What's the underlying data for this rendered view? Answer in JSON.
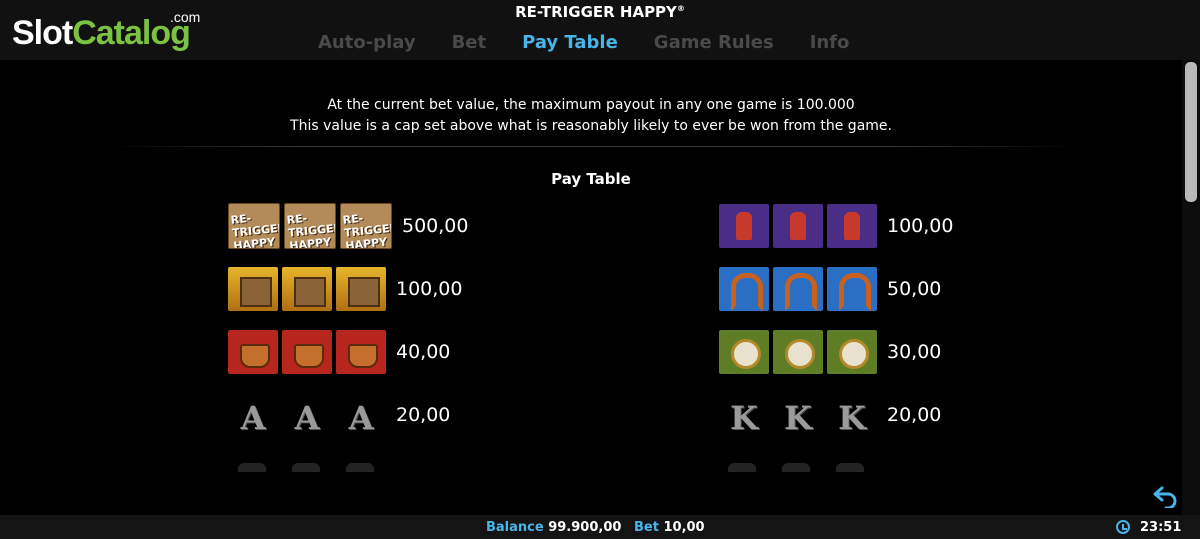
{
  "branding": {
    "logo_slot": "Slot",
    "logo_catalog": "Catalog",
    "logo_com": ".com"
  },
  "header": {
    "title": "RE-TRIGGER HAPPY",
    "trademark": "®"
  },
  "tabs": [
    {
      "label": "Auto-play",
      "active": false
    },
    {
      "label": "Bet",
      "active": false
    },
    {
      "label": "Pay Table",
      "active": true
    },
    {
      "label": "Game Rules",
      "active": false
    },
    {
      "label": "Info",
      "active": false
    }
  ],
  "notice": {
    "line1": "At the current bet value, the maximum payout in any one game is 100.000",
    "line2": "This value is a cap set above what is reasonably likely to ever be won from the game."
  },
  "section_title": "Pay Table",
  "pay_table": {
    "left": [
      {
        "symbol": "retrigger-happy-logo",
        "logo_text": "RE-TRIGGER HAPPY",
        "payout": "500,00"
      },
      {
        "symbol": "saloon",
        "payout": "100,00"
      },
      {
        "symbol": "bucket",
        "payout": "40,00"
      },
      {
        "symbol": "ace",
        "letter": "A",
        "payout": "20,00"
      }
    ],
    "right": [
      {
        "symbol": "bandit",
        "payout": "100,00"
      },
      {
        "symbol": "horseshoe",
        "payout": "50,00"
      },
      {
        "symbol": "pocket-watch",
        "payout": "30,00"
      },
      {
        "symbol": "king",
        "letter": "K",
        "payout": "20,00"
      }
    ]
  },
  "status": {
    "balance_label": "Balance",
    "balance_value": "99.900,00",
    "bet_label": "Bet",
    "bet_value": "10,00",
    "time": "23:51"
  },
  "colors": {
    "accent": "#48b4e8",
    "logo_green": "#7cc242",
    "background": "#000000"
  },
  "icons": {
    "back": "back-arrow-icon",
    "clock": "clock-icon"
  }
}
